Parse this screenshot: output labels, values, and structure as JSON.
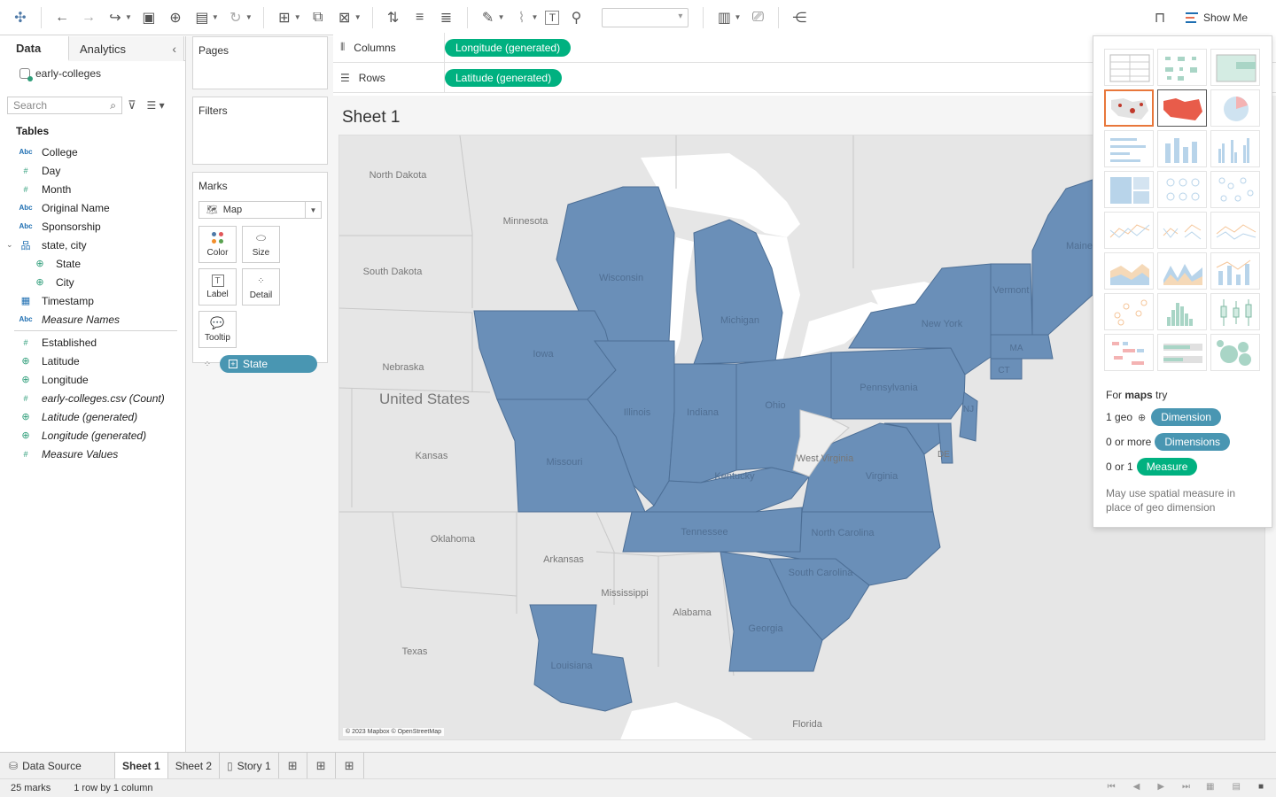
{
  "toolbar": {
    "show_me_label": "Show Me"
  },
  "data_pane": {
    "tab_data": "Data",
    "tab_analytics": "Analytics",
    "datasource": "early-colleges",
    "search_placeholder": "Search",
    "tables_heading": "Tables",
    "fields": [
      {
        "type": "Abc",
        "name": "College"
      },
      {
        "type": "#",
        "name": "Day"
      },
      {
        "type": "#",
        "name": "Month"
      },
      {
        "type": "Abc",
        "name": "Original Name"
      },
      {
        "type": "Abc",
        "name": "Sponsorship"
      },
      {
        "type": "hier",
        "name": "state, city"
      },
      {
        "type": "geo",
        "name": "State"
      },
      {
        "type": "geo",
        "name": "City"
      },
      {
        "type": "date",
        "name": "Timestamp"
      },
      {
        "type": "Abc",
        "name": "Measure Names"
      },
      {
        "type": "#",
        "name": "Established"
      },
      {
        "type": "geo",
        "name": "Latitude"
      },
      {
        "type": "geo",
        "name": "Longitude"
      },
      {
        "type": "#",
        "name": "early-colleges.csv (Count)"
      },
      {
        "type": "geo",
        "name": "Latitude (generated)"
      },
      {
        "type": "geo",
        "name": "Longitude (generated)"
      },
      {
        "type": "#",
        "name": "Measure Values"
      }
    ]
  },
  "cards": {
    "pages": "Pages",
    "filters": "Filters",
    "marks": "Marks",
    "mark_type": "Map",
    "color": "Color",
    "size": "Size",
    "label": "Label",
    "detail": "Detail",
    "tooltip": "Tooltip",
    "detail_pill": "State"
  },
  "shelves": {
    "columns_label": "Columns",
    "rows_label": "Rows",
    "columns_pill": "Longitude (generated)",
    "rows_pill": "Latitude (generated)"
  },
  "sheet": {
    "title": "Sheet 1",
    "attribution": "© 2023 Mapbox © OpenStreetMap",
    "map_labels": {
      "north_dakota": "North Dakota",
      "minnesota": "Minnesota",
      "south_dakota": "South Dakota",
      "nebraska": "Nebraska",
      "united_states": "United States",
      "kansas": "Kansas",
      "oklahoma": "Oklahoma",
      "arkansas": "Arkansas",
      "texas": "Texas",
      "mississippi": "Mississippi",
      "alabama": "Alabama",
      "florida": "Florida",
      "west_virginia": "West Virginia",
      "de": "DE",
      "wisconsin": "Wisconsin",
      "michigan": "Michigan",
      "iowa": "Iowa",
      "illinois": "Illinois",
      "indiana": "Indiana",
      "ohio": "Ohio",
      "missouri": "Missouri",
      "kentucky": "Kentucky",
      "tennessee": "Tennessee",
      "virginia": "Virginia",
      "north_carolina": "North Carolina",
      "south_carolina": "South Carolina",
      "georgia": "Georgia",
      "louisiana": "Louisiana",
      "pennsylvania": "Pennsylvania",
      "new_york": "New York",
      "vermont": "Vermont",
      "maine": "Maine",
      "ma": "MA",
      "ct": "CT",
      "nj": "NJ"
    }
  },
  "show_me": {
    "for_label_prefix": "For ",
    "for_label_bold": "maps",
    "for_label_suffix": " try",
    "req1_count": "1 geo",
    "req1_pill": "Dimension",
    "req2_count": "0 or more",
    "req2_pill": "Dimensions",
    "req3_count": "0 or 1",
    "req3_pill": "Measure",
    "note": "May use spatial measure in place of geo dimension"
  },
  "tabs": {
    "data_source": "Data Source",
    "sheet1": "Sheet 1",
    "sheet2": "Sheet 2",
    "story1": "Story 1"
  },
  "status": {
    "marks": "25 marks",
    "dims": "1 row by 1 column"
  },
  "colors": {
    "state_fill": "#6a8fb8",
    "pill_blue": "#4996b2",
    "pill_green": "#00b180",
    "map_bg": "#e9e9e9",
    "water": "#ffffff"
  }
}
